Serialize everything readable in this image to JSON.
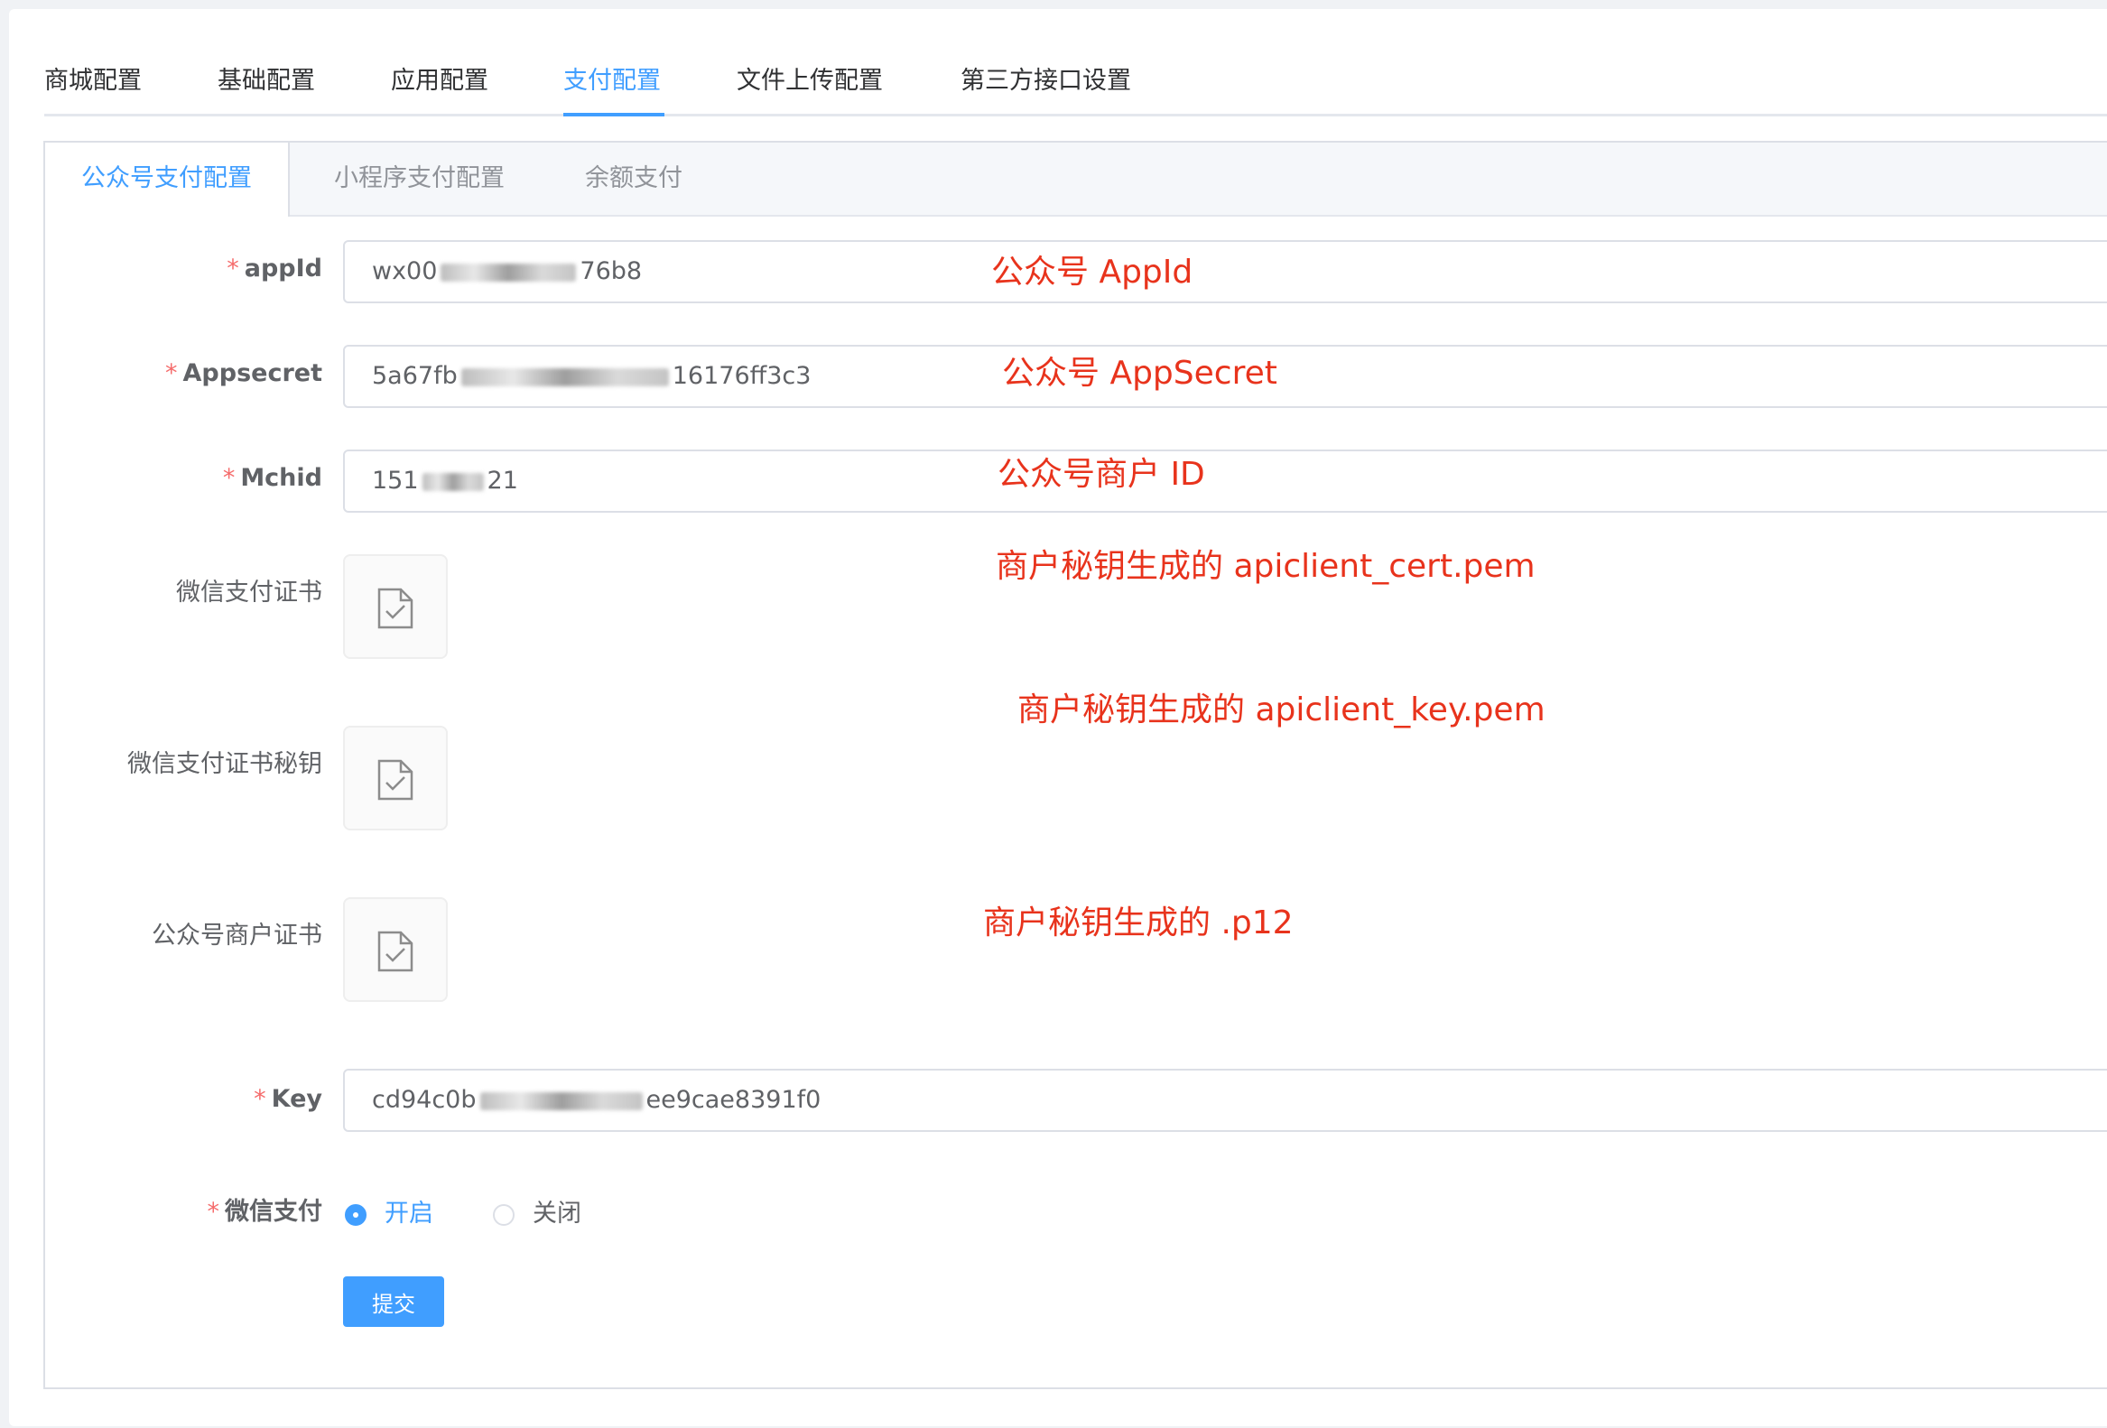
{
  "top_tabs": [
    "商城配置",
    "基础配置",
    "应用配置",
    "支付配置",
    "文件上传配置",
    "第三方接口设置"
  ],
  "active_top_tab": "支付配置",
  "sub_tabs": [
    "公众号支付配置",
    "小程序支付配置",
    "余额支付"
  ],
  "active_sub_tab": "公众号支付配置",
  "form": {
    "appid": {
      "label": "appId",
      "value_prefix": "wx00",
      "value_suffix": "76b8"
    },
    "appsecret": {
      "label": "Appsecret",
      "value_prefix": "5a67fb",
      "value_suffix": "16176ff3c3"
    },
    "mchid": {
      "label": "Mchid",
      "value_prefix": "151",
      "value_suffix": "21"
    },
    "cert_label": "微信支付证书",
    "cert_key_label": "微信支付证书秘钥",
    "merchant_cert_label": "公众号商户证书",
    "key": {
      "label": "Key",
      "value_prefix": "cd94c0b",
      "value_suffix": "ee9cae8391f0"
    },
    "wechat_pay_label": "微信支付",
    "radio_on": "开启",
    "radio_off": "关闭",
    "submit": "提交",
    "required_mark": "*"
  },
  "annotations": {
    "appid": "公众号 AppId",
    "appsecret": "公众号 AppSecret",
    "mchid": "公众号商户 ID",
    "cert": "商户秘钥生成的 apiclient_cert.pem",
    "key_pem": "商户秘钥生成的 apiclient_key.pem",
    "p12": "商户秘钥生成的 .p12"
  },
  "colors": {
    "accent": "#409eff",
    "annotation": "#e8331c",
    "required": "#f56c6c"
  }
}
